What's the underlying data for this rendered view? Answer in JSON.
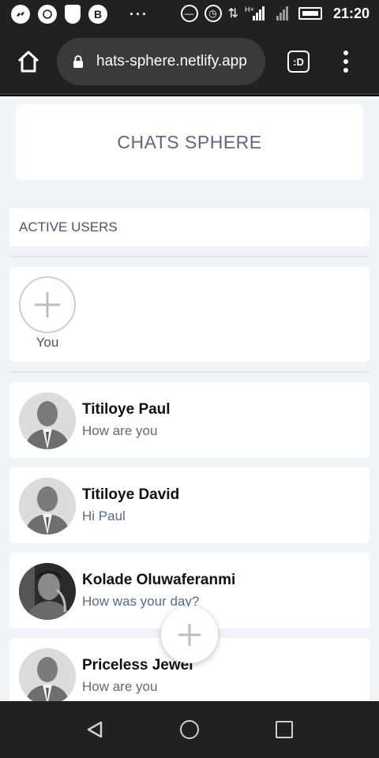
{
  "status_bar": {
    "time": "21:20",
    "app_icon_letter": "B",
    "network_label": "H+",
    "icons": [
      "messenger-icon",
      "whatsapp-icon",
      "shield-icon",
      "bitcoin-icon",
      "more-dots-icon",
      "dnd-icon",
      "alarm-icon",
      "data-arrows-icon",
      "signal-icon",
      "signal-icon-2",
      "battery-icon"
    ]
  },
  "browser": {
    "url": "hats-sphere.netlify.app",
    "tab_label": ":D"
  },
  "app": {
    "title": "CHATS SPHERE",
    "active_users_heading": "ACTIVE USERS",
    "active_users": [
      {
        "label": "You"
      }
    ],
    "chats": [
      {
        "name": "Titiloye Paul",
        "message": "How are you",
        "avatar": "placeholder"
      },
      {
        "name": "Titiloye David",
        "message": "Hi Paul",
        "avatar": "placeholder"
      },
      {
        "name": "Kolade Oluwaferanmi",
        "message": "How was your day?",
        "avatar": "photo"
      },
      {
        "name": "Priceless Jewel",
        "message": "How are you",
        "avatar": "placeholder"
      }
    ]
  },
  "colors": {
    "chrome_bg": "#212121",
    "content_bg": "#f0f3f8",
    "muted_text": "#5a6a82"
  }
}
